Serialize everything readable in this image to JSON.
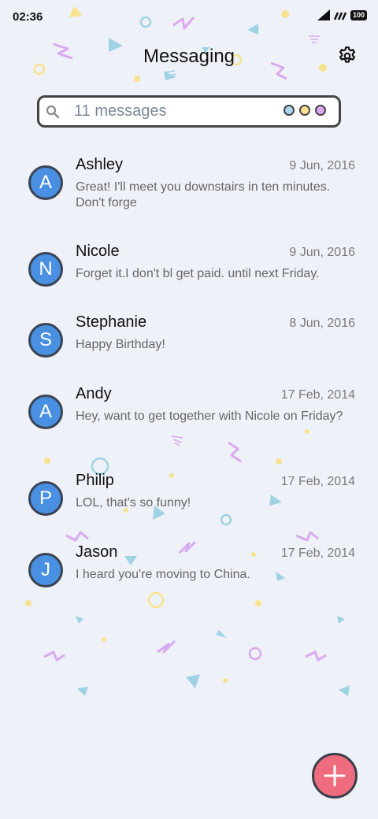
{
  "status": {
    "time": "02:36",
    "battery": "100"
  },
  "header": {
    "title": "Messaging"
  },
  "search": {
    "placeholder": "11 messages",
    "filter_colors": [
      "#a8d8ea",
      "#f7e28f",
      "#d8a9f0"
    ]
  },
  "conversations": [
    {
      "initial": "A",
      "name": "Ashley",
      "date": "9 Jun, 2016",
      "snippet": "Great! I'll meet you downstairs in ten minutes. Don't forge"
    },
    {
      "initial": "N",
      "name": "Nicole",
      "date": "9 Jun, 2016",
      "snippet": "Forget it.I don't bl get paid. until next Friday."
    },
    {
      "initial": "S",
      "name": "Stephanie",
      "date": "8 Jun, 2016",
      "snippet": "Happy Birthday!"
    },
    {
      "initial": "A",
      "name": "Andy",
      "date": "17 Feb, 2014",
      "snippet": "Hey, want to get together with Nicole on Friday?"
    },
    {
      "initial": "P",
      "name": "Philip",
      "date": "17 Feb, 2014",
      "snippet": "LOL, that's so funny!"
    },
    {
      "initial": "J",
      "name": "Jason",
      "date": "17 Feb, 2014",
      "snippet": "I heard you're moving to China."
    }
  ],
  "colors": {
    "avatar": "#4a90e2",
    "fab": "#ef6b7e",
    "background": "#eef1f7"
  },
  "icons": {
    "settings": "gear-icon",
    "search": "search-icon",
    "fab": "plus-icon"
  }
}
